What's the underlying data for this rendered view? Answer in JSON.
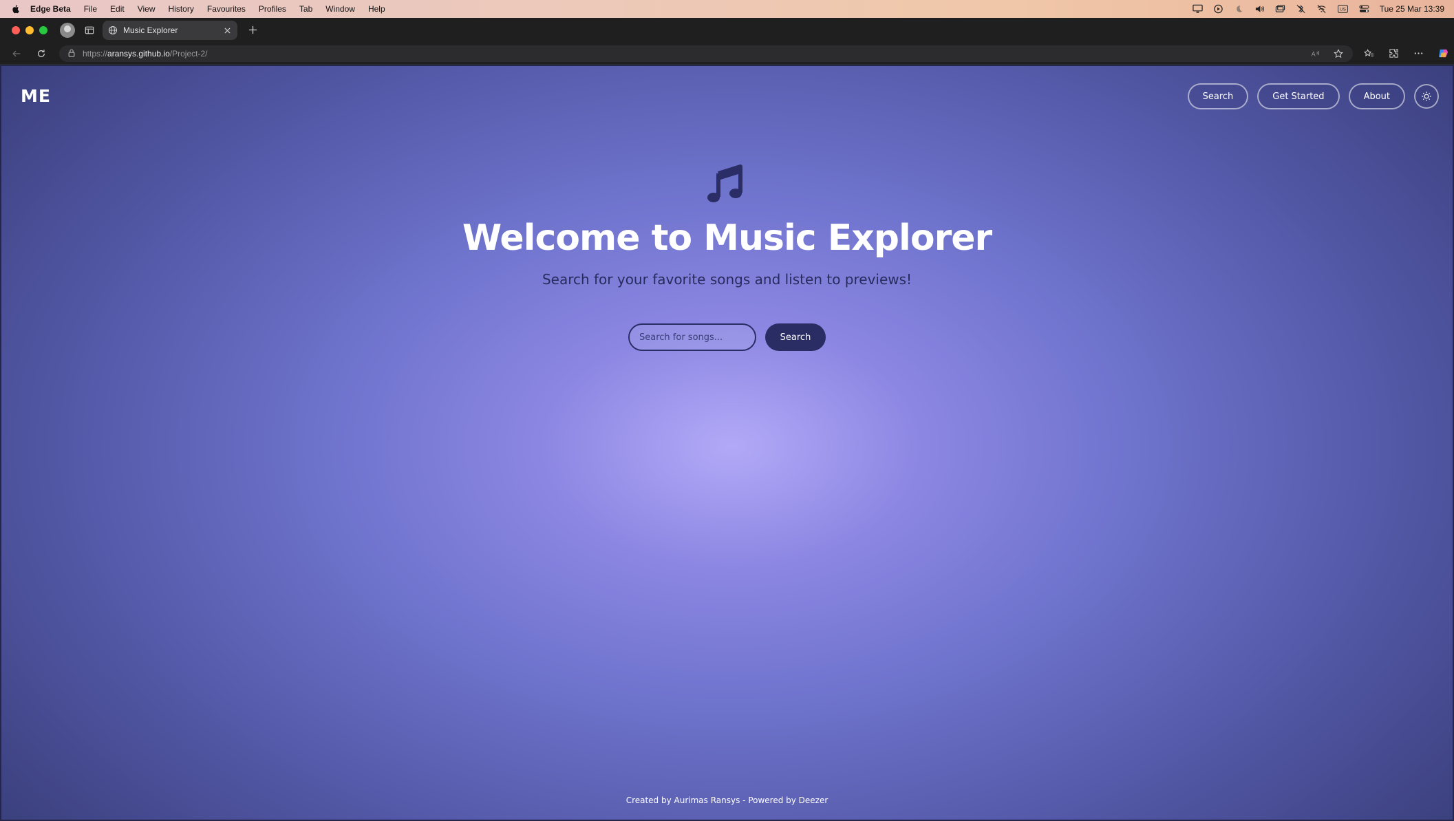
{
  "menubar": {
    "app_name": "Edge Beta",
    "items": [
      "File",
      "Edit",
      "View",
      "History",
      "Favourites",
      "Profiles",
      "Tab",
      "Window",
      "Help"
    ],
    "keyboard_layout": "US",
    "clock": "Tue 25 Mar  13:39"
  },
  "browser": {
    "tab_title": "Music Explorer",
    "url_scheme": "https://",
    "url_host": "aransys.github.io",
    "url_path": "/Project-2/"
  },
  "site": {
    "logo": "ME",
    "nav": {
      "search": "Search",
      "get_started": "Get Started",
      "about": "About"
    },
    "hero": {
      "title": "Welcome to Music Explorer",
      "subtitle": "Search for your favorite songs and listen to previews!",
      "search_placeholder": "Search for songs...",
      "search_button": "Search"
    },
    "footer": "Created by Aurimas Ransys - Powered by Deezer"
  },
  "colors": {
    "accent_dark": "#2a2d64",
    "gradient_center": "#b2a9f7",
    "gradient_edge": "#383d79"
  }
}
